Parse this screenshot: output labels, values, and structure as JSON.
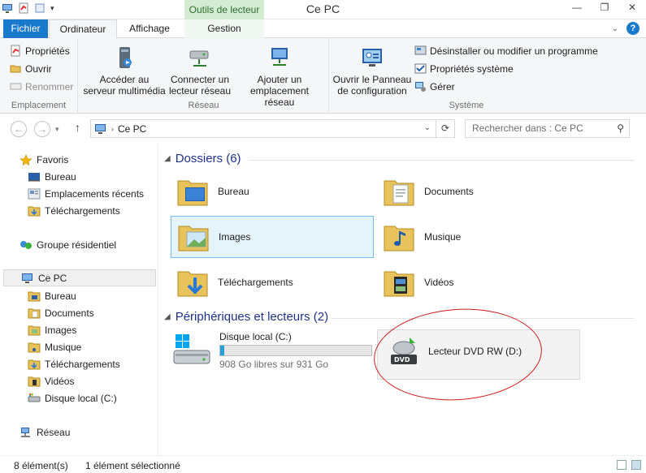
{
  "window": {
    "title": "Ce PC",
    "contextual_tab": "Outils de lecteur",
    "controls": [
      "—",
      "❐",
      "✕"
    ]
  },
  "ribbon_tabs": {
    "file": "Fichier",
    "computer": "Ordinateur",
    "view": "Affichage",
    "manage": "Gestion"
  },
  "ribbon": {
    "location": {
      "properties": "Propriétés",
      "open": "Ouvrir",
      "rename": "Renommer",
      "label": "Emplacement"
    },
    "network": {
      "media_server": "Accéder au serveur multimédia",
      "map_drive": "Connecter un lecteur réseau",
      "add_location": "Ajouter un emplacement réseau",
      "label": "Réseau"
    },
    "system": {
      "control_panel": "Ouvrir le Panneau de configuration",
      "uninstall": "Désinstaller ou modifier un programme",
      "sys_props": "Propriétés système",
      "manage": "Gérer",
      "label": "Système"
    }
  },
  "address": {
    "path": "Ce PC",
    "search_placeholder": "Rechercher dans : Ce PC"
  },
  "navpane": {
    "favorites": "Favoris",
    "fav_items": [
      "Bureau",
      "Emplacements récents",
      "Téléchargements"
    ],
    "homegroup": "Groupe résidentiel",
    "thispc": "Ce PC",
    "pc_items": [
      "Bureau",
      "Documents",
      "Images",
      "Musique",
      "Téléchargements",
      "Vidéos",
      "Disque local (C:)"
    ],
    "network": "Réseau"
  },
  "content": {
    "folders_header": "Dossiers (6)",
    "folders": [
      "Bureau",
      "Documents",
      "Images",
      "Musique",
      "Téléchargements",
      "Vidéos"
    ],
    "devices_header": "Périphériques et lecteurs (2)",
    "drive_c": {
      "name": "Disque local (C:)",
      "free": "908 Go libres sur 931 Go",
      "used_fraction": 0.025
    },
    "drive_d": {
      "name": "Lecteur DVD RW (D:)"
    }
  },
  "status": {
    "count": "8 élément(s)",
    "selected": "1 élément sélectionné"
  }
}
